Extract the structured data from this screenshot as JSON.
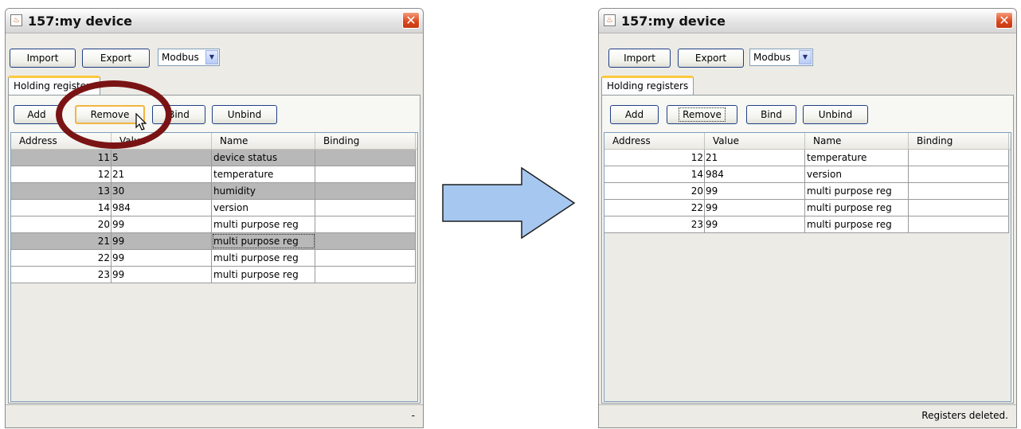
{
  "left_window": {
    "title": "157:my device",
    "toolbar": {
      "import_label": "Import",
      "export_label": "Export",
      "protocol": "Modbus"
    },
    "tab_label": "Holding registers",
    "actions": {
      "add": "Add",
      "remove": "Remove",
      "bind": "Bind",
      "unbind": "Unbind"
    },
    "columns": [
      "Address",
      "Value",
      "Name",
      "Binding"
    ],
    "rows": [
      {
        "address": "11",
        "value": "5",
        "name": "device status",
        "binding": "",
        "selected": true
      },
      {
        "address": "12",
        "value": "21",
        "name": "temperature",
        "binding": "",
        "selected": false
      },
      {
        "address": "13",
        "value": "30",
        "name": "humidity",
        "binding": "",
        "selected": true
      },
      {
        "address": "14",
        "value": "984",
        "name": "version",
        "binding": "",
        "selected": false
      },
      {
        "address": "20",
        "value": "99",
        "name": "multi purpose reg",
        "binding": "",
        "selected": false
      },
      {
        "address": "21",
        "value": "99",
        "name": "multi purpose reg",
        "binding": "",
        "selected": true
      },
      {
        "address": "22",
        "value": "99",
        "name": "multi purpose reg",
        "binding": "",
        "selected": false
      },
      {
        "address": "23",
        "value": "99",
        "name": "multi purpose reg",
        "binding": "",
        "selected": false
      }
    ],
    "status": "-"
  },
  "right_window": {
    "title": "157:my device",
    "toolbar": {
      "import_label": "Import",
      "export_label": "Export",
      "protocol": "Modbus"
    },
    "tab_label": "Holding registers",
    "actions": {
      "add": "Add",
      "remove": "Remove",
      "bind": "Bind",
      "unbind": "Unbind"
    },
    "columns": [
      "Address",
      "Value",
      "Name",
      "Binding"
    ],
    "rows": [
      {
        "address": "12",
        "value": "21",
        "name": "temperature",
        "binding": ""
      },
      {
        "address": "14",
        "value": "984",
        "name": "version",
        "binding": ""
      },
      {
        "address": "20",
        "value": "99",
        "name": "multi purpose reg",
        "binding": ""
      },
      {
        "address": "22",
        "value": "99",
        "name": "multi purpose reg",
        "binding": ""
      },
      {
        "address": "23",
        "value": "99",
        "name": "multi purpose reg",
        "binding": ""
      }
    ],
    "status": "Registers deleted."
  },
  "colors": {
    "accent_ring": "#7a1414",
    "arrow_fill": "#a6c8f0",
    "selected_row": "#b8b8b8",
    "close_button": "#d9461b",
    "tab_highlight": "#ffc83c"
  }
}
